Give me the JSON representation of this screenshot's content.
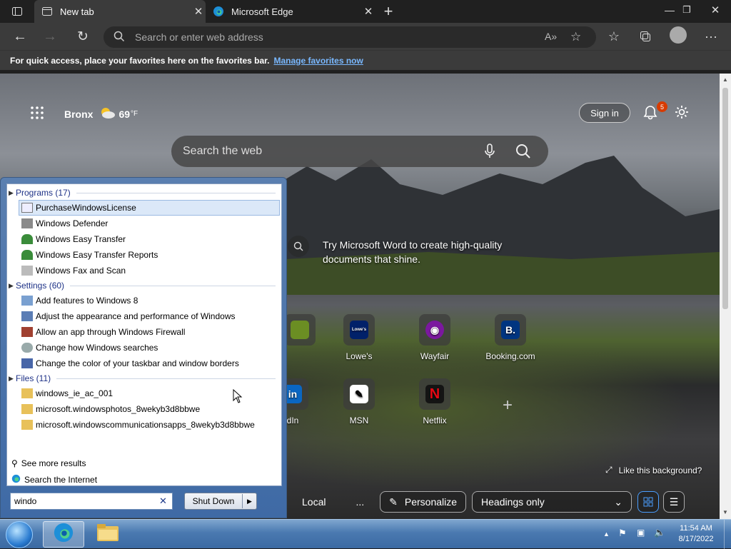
{
  "browser": {
    "tabs": [
      {
        "label": "New tab"
      },
      {
        "label": "Microsoft Edge"
      }
    ],
    "address_placeholder": "Search or enter web address",
    "favorites_bar": {
      "text": "For quick access, place your favorites here on the favorites bar.",
      "link": "Manage favorites now"
    }
  },
  "ntp": {
    "location": "Bronx",
    "temperature": "69",
    "temp_unit": "°F",
    "search_placeholder": "Search the web",
    "sign_in": "Sign in",
    "notification_count": "5",
    "promo": "Try Microsoft Word to create high-quality documents that shine.",
    "tiles_row1": [
      {
        "label": "",
        "letter": "",
        "color": "#6b8e23"
      },
      {
        "label": "Lowe's",
        "letter": "Lowe's",
        "color": "#012169"
      },
      {
        "label": "Wayfair",
        "letter": "◉",
        "color": "#7b189f"
      },
      {
        "label": "Booking.com",
        "letter": "B.",
        "color": "#003580"
      }
    ],
    "tiles_row2": [
      {
        "label": "dIn",
        "letter": "in",
        "color": "#0a66c2"
      },
      {
        "label": "MSN",
        "letter": "✎",
        "color": "#ffffff"
      },
      {
        "label": "Netflix",
        "letter": "N",
        "color": "#141414"
      }
    ],
    "like_background": "Like this background?",
    "bottom": {
      "local": "Local",
      "more": "...",
      "personalize": "Personalize",
      "headings": "Headings only"
    }
  },
  "start_menu": {
    "groups": [
      {
        "header": "Programs (17)",
        "items": [
          "PurchaseWindowsLicense",
          "Windows Defender",
          "Windows Easy Transfer",
          "Windows Easy Transfer Reports",
          "Windows Fax and Scan"
        ]
      },
      {
        "header": "Settings (60)",
        "items": [
          "Add features to Windows 8",
          "Adjust the appearance and performance of Windows",
          "Allow an app through Windows Firewall",
          "Change how Windows searches",
          "Change the color of your taskbar and window borders"
        ]
      },
      {
        "header": "Files (11)",
        "items": [
          "windows_ie_ac_001",
          "microsoft.windowsphotos_8wekyb3d8bbwe",
          "microsoft.windowscommunicationsapps_8wekyb3d8bbwe"
        ]
      }
    ],
    "see_more": "See more results",
    "search_internet": "Search the Internet",
    "search_value": "windo",
    "shutdown": "Shut Down"
  },
  "taskbar": {
    "time": "11:54 AM",
    "date": "8/17/2022"
  }
}
